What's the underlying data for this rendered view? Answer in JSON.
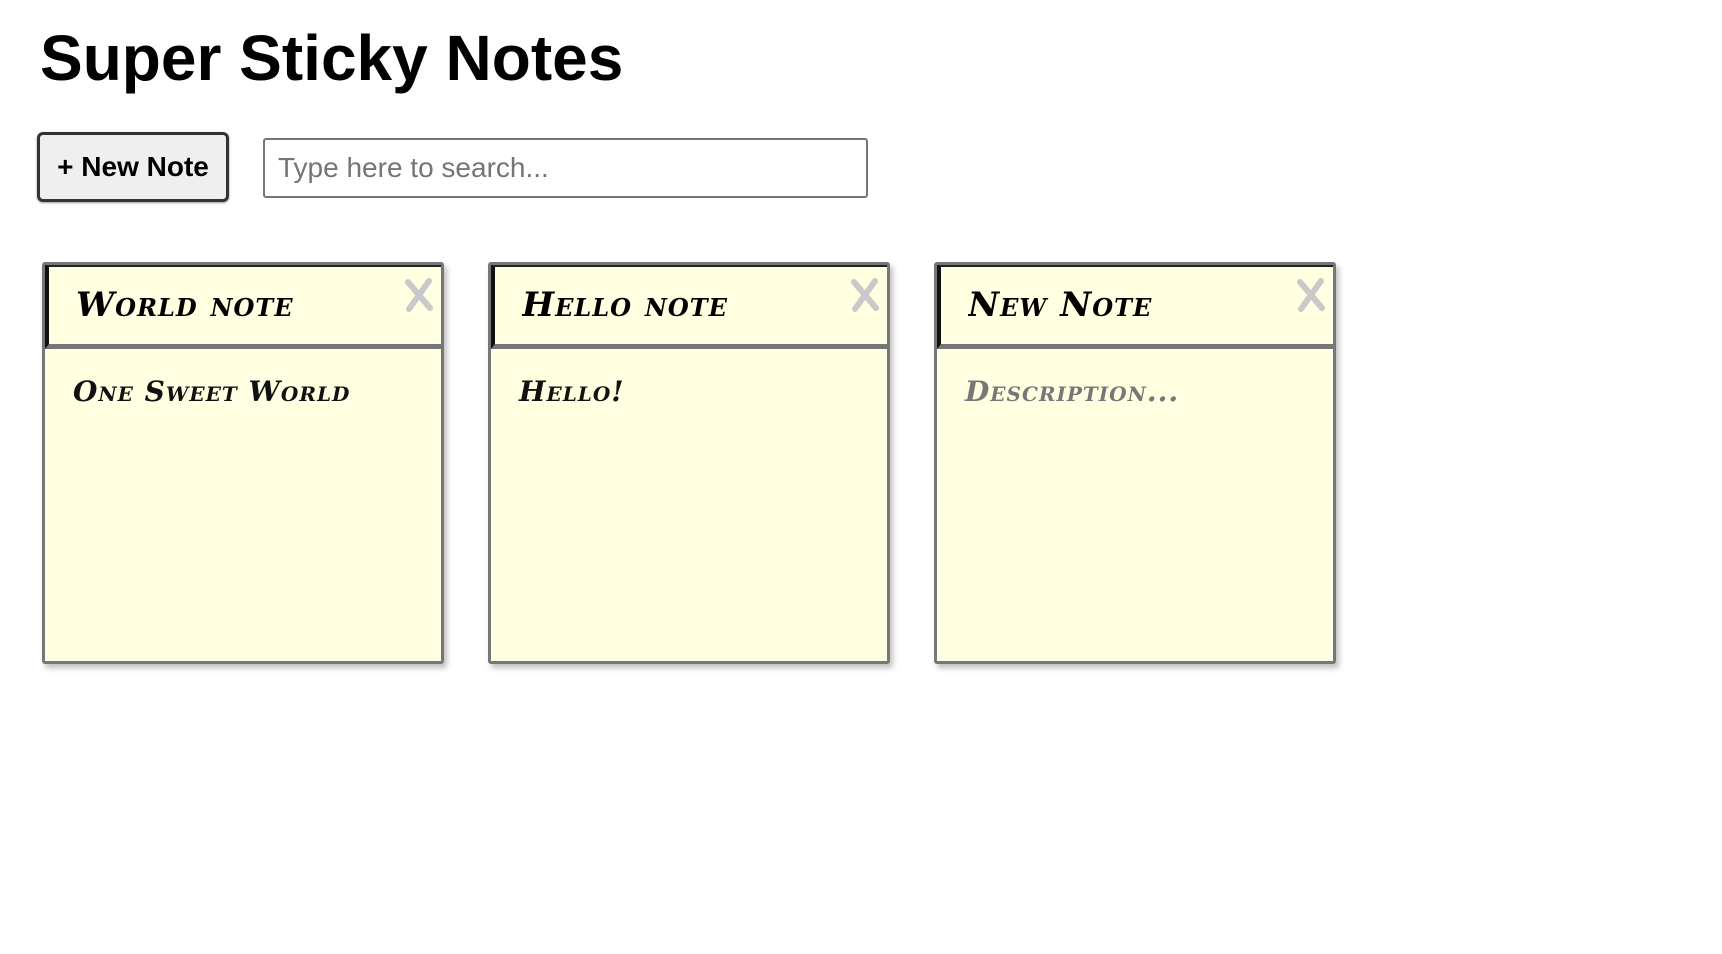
{
  "page": {
    "title": "Super Sticky Notes"
  },
  "toolbar": {
    "new_note_label": "+ New Note",
    "search_placeholder": "Type here to search...",
    "search_value": ""
  },
  "notes": [
    {
      "title": "World note",
      "description": "One Sweet World",
      "description_placeholder": "Description..."
    },
    {
      "title": "Hello note",
      "description": "Hello!",
      "description_placeholder": "Description..."
    },
    {
      "title": "New Note",
      "description": "",
      "description_placeholder": "Description..."
    }
  ],
  "colors": {
    "note_background": "#ffffe1",
    "note_border": "#777777",
    "close_icon": "#c9c9c9"
  },
  "icons": {
    "close": "close-icon"
  }
}
